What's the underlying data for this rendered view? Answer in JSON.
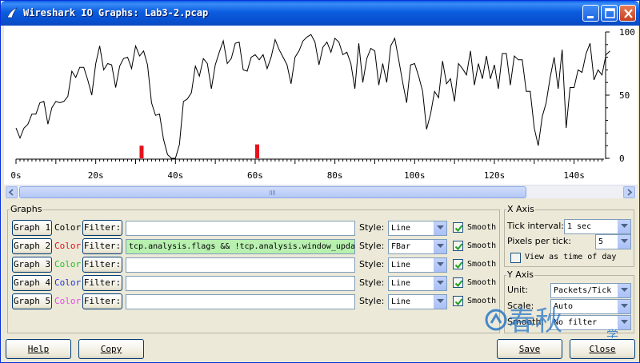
{
  "window": {
    "title": "Wireshark IO Graphs: Lab3-2.pcap"
  },
  "chart_data": {
    "type": "line",
    "xlabel": "",
    "ylabel": "",
    "xlim": [
      0,
      147
    ],
    "ylim": [
      0,
      100
    ],
    "x_ticks": [
      "0s",
      "20s",
      "40s",
      "60s",
      "80s",
      "100s",
      "120s",
      "140s"
    ],
    "x_tick_values": [
      0,
      20,
      40,
      60,
      80,
      100,
      120,
      140
    ],
    "y_ticks": [
      "0",
      "50",
      "100"
    ],
    "y_tick_values": [
      0,
      50,
      100
    ],
    "series": [
      {
        "color": "#000000",
        "style": "line",
        "values": [
          24,
          16,
          24,
          27,
          35,
          35,
          44,
          45,
          27,
          40,
          45,
          44,
          45,
          49,
          69,
          64,
          72,
          72,
          62,
          50,
          75,
          89,
          70,
          75,
          74,
          56,
          73,
          79,
          80,
          71,
          89,
          81,
          85,
          74,
          44,
          34,
          35,
          15,
          3,
          0,
          0,
          11,
          45,
          47,
          52,
          73,
          65,
          79,
          75,
          55,
          74,
          84,
          93,
          75,
          79,
          91,
          92,
          70,
          69,
          80,
          82,
          78,
          82,
          71,
          80,
          94,
          86,
          80,
          74,
          59,
          80,
          85,
          93,
          96,
          98,
          92,
          74,
          88,
          92,
          84,
          95,
          92,
          82,
          84,
          75,
          55,
          91,
          60,
          79,
          87,
          85,
          58,
          75,
          60,
          89,
          95,
          78,
          60,
          44,
          74,
          75,
          65,
          53,
          23,
          35,
          53,
          48,
          77,
          59,
          63,
          45,
          75,
          71,
          66,
          85,
          58,
          75,
          63,
          81,
          63,
          74,
          55,
          83,
          83,
          58,
          81,
          78,
          78,
          53,
          53,
          24,
          10,
          33,
          44,
          64,
          80,
          55,
          86,
          24,
          56,
          56,
          70,
          68,
          83,
          91,
          62,
          70,
          66,
          82,
          85
        ]
      },
      {
        "color": "#e8101a",
        "style": "fbar",
        "bars": [
          {
            "x": 31.5,
            "y": 10
          },
          {
            "x": 60.5,
            "y": 11
          }
        ]
      }
    ]
  },
  "graphs_group": {
    "label": "Graphs",
    "rows": [
      {
        "graph_label": "Graph 1",
        "color_label": "Color",
        "color": "#000000",
        "filter_label": "Filter:",
        "filter_value": "",
        "style_label": "Style:",
        "style_value": "Line",
        "smooth_label": "Smooth",
        "smooth_checked": true,
        "active": true
      },
      {
        "graph_label": "Graph 2",
        "color_label": "Color",
        "color": "#e8101a",
        "filter_label": "Filter:",
        "filter_value": "tcp.analysis.flags && !tcp.analysis.window_upda",
        "style_label": "Style:",
        "style_value": "FBar",
        "smooth_label": "Smooth",
        "smooth_checked": true,
        "active": true
      },
      {
        "graph_label": "Graph 3",
        "color_label": "Color",
        "color": "#22c422",
        "filter_label": "Filter:",
        "filter_value": "",
        "style_label": "Style:",
        "style_value": "Line",
        "smooth_label": "Smooth",
        "smooth_checked": true,
        "active": false
      },
      {
        "graph_label": "Graph 4",
        "color_label": "Color",
        "color": "#1f2ee0",
        "filter_label": "Filter:",
        "filter_value": "",
        "style_label": "Style:",
        "style_value": "Line",
        "smooth_label": "Smooth",
        "smooth_checked": true,
        "active": false
      },
      {
        "graph_label": "Graph 5",
        "color_label": "Color",
        "color": "#ee44ee",
        "filter_label": "Filter:",
        "filter_value": "",
        "style_label": "Style:",
        "style_value": "Line",
        "smooth_label": "Smooth",
        "smooth_checked": true,
        "active": false
      }
    ]
  },
  "x_axis_group": {
    "label": "X Axis",
    "tick_interval_label": "Tick interval:",
    "tick_interval_value": "1 sec",
    "pixels_per_tick_label": "Pixels per tick:",
    "pixels_per_tick_value": "5",
    "view_time_of_day_label": "View as time of day",
    "view_time_of_day_checked": false
  },
  "y_axis_group": {
    "label": "Y Axis",
    "unit_label": "Unit:",
    "unit_value": "Packets/Tick",
    "scale_label": "Scale:",
    "scale_value": "Auto",
    "smooth_label": "Smooth:",
    "smooth_value": "No filter"
  },
  "buttons": {
    "help": "Help",
    "copy": "Copy",
    "save": "Save",
    "close": "Close"
  },
  "watermark": {
    "text": "春秋",
    "side_text": "学院"
  },
  "colors": {
    "accent": "#0a5fe8",
    "filter_highlight": "#b8f0b0"
  }
}
